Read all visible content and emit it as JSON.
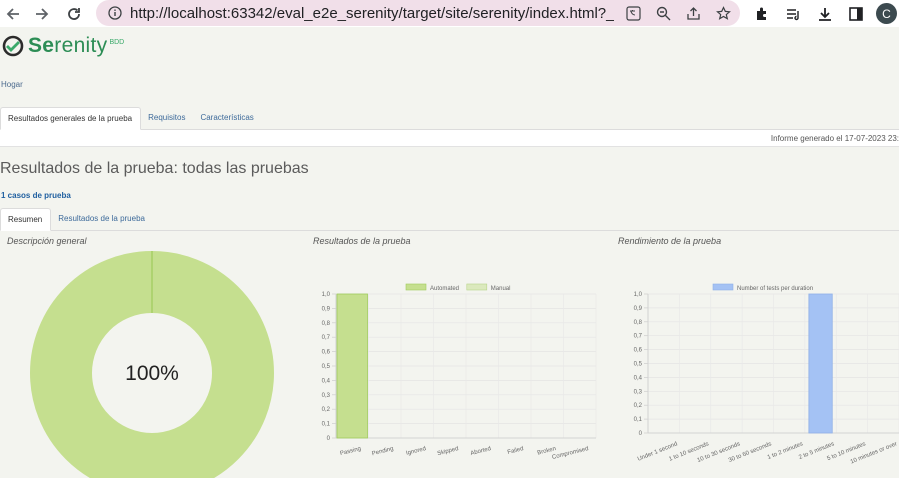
{
  "browser": {
    "url": "http://localhost:63342/eval_e2e_serenity/target/site/serenity/index.html?_ijt...",
    "profile_initial": "C"
  },
  "logo": {
    "brand_prefix": "Se",
    "brand_rest": "renity",
    "suffix": "BDD"
  },
  "breadcrumb": {
    "home": "Hogar"
  },
  "main_tabs": [
    {
      "label": "Resultados generales de la prueba",
      "active": true
    },
    {
      "label": "Requisitos",
      "active": false
    },
    {
      "label": "Características",
      "active": false
    }
  ],
  "report_date": "Informe generado el 17-07-2023 23:",
  "page_title": "Resultados de la prueba: todas las pruebas",
  "test_count": "1 casos de prueba",
  "sub_tabs": [
    {
      "label": "Resumen",
      "active": true
    },
    {
      "label": "Resultados de la prueba",
      "active": false
    }
  ],
  "panels": {
    "overview": "Descripción general",
    "results": "Resultados de la prueba",
    "performance": "Rendimiento de la prueba"
  },
  "colors": {
    "passing": "#c5df8f",
    "passing_border": "#9fcb5c",
    "duration": "#a4c2f4",
    "brand": "#2c8d55"
  },
  "chart_data": [
    {
      "type": "pie",
      "title": "",
      "labels": [
        "Passing"
      ],
      "values": [
        100
      ],
      "center_label": "100%"
    },
    {
      "type": "bar",
      "legend": [
        "Automated",
        "Manual"
      ],
      "categories": [
        "Passing",
        "Pending",
        "Ignored",
        "Skipped",
        "Aborted",
        "Failed",
        "Broken",
        "Compromised"
      ],
      "series": [
        {
          "name": "Automated",
          "values": [
            1,
            0,
            0,
            0,
            0,
            0,
            0,
            0
          ]
        },
        {
          "name": "Manual",
          "values": [
            0,
            0,
            0,
            0,
            0,
            0,
            0,
            0
          ]
        }
      ],
      "yticks": [
        "0",
        "0,1",
        "0,2",
        "0,3",
        "0,4",
        "0,5",
        "0,6",
        "0,7",
        "0,8",
        "0,9",
        "1,0"
      ],
      "ylim": [
        0,
        1
      ]
    },
    {
      "type": "bar",
      "legend": [
        "Number of tests per duration"
      ],
      "categories": [
        "Under 1 second",
        "1 to 10 seconds",
        "10 to 30 seconds",
        "30 to 60 seconds",
        "1 to 2 minutes",
        "2 to 5 minutes",
        "5 to 10 minutes",
        "10 minutes or over"
      ],
      "series": [
        {
          "name": "Number of tests per duration",
          "values": [
            0,
            0,
            0,
            0,
            0,
            1,
            0,
            0
          ]
        }
      ],
      "yticks": [
        "0",
        "0,1",
        "0,2",
        "0,3",
        "0,4",
        "0,5",
        "0,6",
        "0,7",
        "0,8",
        "0,9",
        "1,0"
      ],
      "ylim": [
        0,
        1
      ]
    }
  ]
}
